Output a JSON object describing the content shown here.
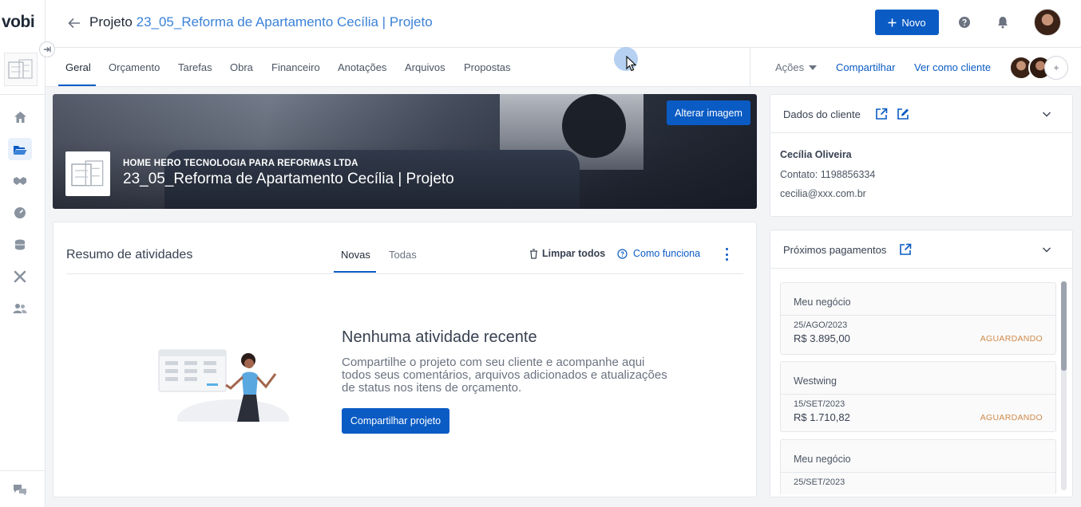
{
  "app": {
    "logo": "vobi"
  },
  "header": {
    "title_prefix": "Projeto",
    "project_name": "23_05_Reforma de Apartamento Cecília | Projeto",
    "new_button": "Novo"
  },
  "tabs": [
    "Geral",
    "Orçamento",
    "Tarefas",
    "Obra",
    "Financeiro",
    "Anotações",
    "Arquivos",
    "Propostas"
  ],
  "tabs_right": {
    "actions": "Ações",
    "share": "Compartilhar",
    "view_as_client": "Ver como cliente",
    "add": "+"
  },
  "banner": {
    "company": "HOME HERO TECNOLOGIA PARA REFORMAS LTDA",
    "title": "23_05_Reforma de Apartamento Cecília | Projeto",
    "change_image": "Alterar imagem"
  },
  "activity": {
    "title": "Resumo de atividades",
    "tab_new": "Novas",
    "tab_all": "Todas",
    "clear_all": "Limpar todos",
    "how_it_works": "Como funciona",
    "empty_title": "Nenhuma atividade recente",
    "empty_text": "Compartilhe o projeto com seu cliente e acompanhe aqui todos seus comentários, arquivos adicionados e atualizações de status nos itens de orçamento.",
    "share_button": "Compartilhar projeto"
  },
  "client": {
    "title": "Dados do cliente",
    "name": "Cecília Oliveira",
    "contact": "Contato: 1198856334",
    "email": "cecilia@xxx.com.br"
  },
  "payments": {
    "title": "Próximos pagamentos",
    "items": [
      {
        "name": "Meu negócio",
        "date": "25/AGO/2023",
        "value": "R$ 3.895,00",
        "status": "AGUARDANDO"
      },
      {
        "name": "Westwing",
        "date": "15/SET/2023",
        "value": "R$ 1.710,82",
        "status": "AGUARDANDO"
      },
      {
        "name": "Meu negócio",
        "date": "25/SET/2023",
        "value": "",
        "status": ""
      }
    ]
  },
  "colors": {
    "primary": "#0a5bc4",
    "link": "#3b82d8",
    "status_waiting": "#d08a4a"
  }
}
